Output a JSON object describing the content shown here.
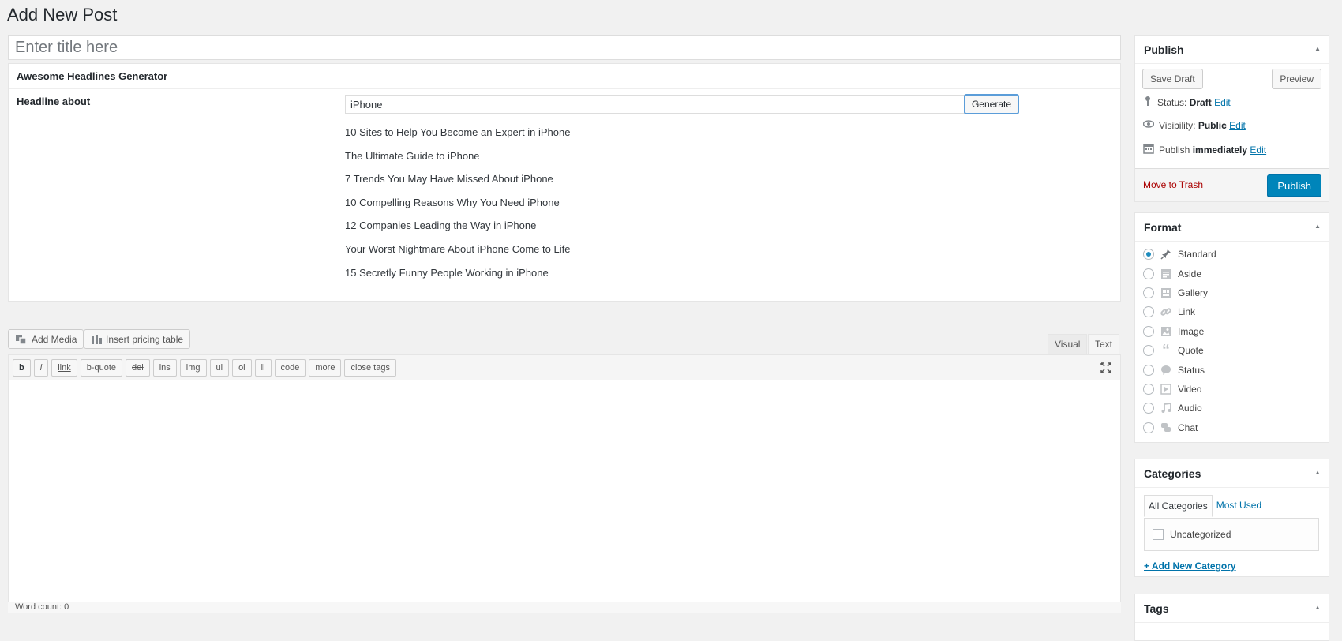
{
  "page": {
    "title": "Add New Post"
  },
  "title_field": {
    "placeholder": "Enter title here"
  },
  "headlines": {
    "box_title": "Awesome Headlines Generator",
    "label": "Headline about",
    "input_value": "iPhone",
    "generate_label": "Generate",
    "results": [
      "10 Sites to Help You Become an Expert in iPhone",
      "The Ultimate Guide to iPhone",
      "7 Trends You May Have Missed About iPhone",
      "10 Compelling Reasons Why You Need iPhone",
      "12 Companies Leading the Way in iPhone",
      "Your Worst Nightmare About iPhone Come to Life",
      "15 Secretly Funny People Working in iPhone"
    ]
  },
  "media": {
    "add_media": "Add Media",
    "insert_pricing": "Insert pricing table"
  },
  "editor": {
    "tabs": [
      "Visual",
      "Text"
    ],
    "active_tab": "Text",
    "quicktags": [
      "b",
      "i",
      "link",
      "b-quote",
      "del",
      "ins",
      "img",
      "ul",
      "ol",
      "li",
      "code",
      "more",
      "close tags"
    ],
    "word_count": "Word count: 0"
  },
  "publish": {
    "title": "Publish",
    "save_draft": "Save Draft",
    "preview": "Preview",
    "status_label": "Status:",
    "status_value": "Draft",
    "visibility_label": "Visibility:",
    "visibility_value": "Public",
    "publish_label": "Publish",
    "publish_value": "immediately",
    "edit": "Edit",
    "trash": "Move to Trash",
    "publish_button": "Publish"
  },
  "format": {
    "title": "Format",
    "selected": "Standard",
    "options": [
      {
        "label": "Standard",
        "icon": "pin-icon"
      },
      {
        "label": "Aside",
        "icon": "aside-icon"
      },
      {
        "label": "Gallery",
        "icon": "gallery-icon"
      },
      {
        "label": "Link",
        "icon": "link-icon"
      },
      {
        "label": "Image",
        "icon": "image-icon"
      },
      {
        "label": "Quote",
        "icon": "quote-icon"
      },
      {
        "label": "Status",
        "icon": "status-icon"
      },
      {
        "label": "Video",
        "icon": "video-icon"
      },
      {
        "label": "Audio",
        "icon": "audio-icon"
      },
      {
        "label": "Chat",
        "icon": "chat-icon"
      }
    ]
  },
  "categories": {
    "title": "Categories",
    "tab_all": "All Categories",
    "tab_most_used": "Most Used",
    "items": [
      "Uncategorized"
    ],
    "add_new": "+ Add New Category"
  },
  "tags": {
    "title": "Tags"
  },
  "colors": {
    "accent": "#0085ba",
    "link": "#0073aa",
    "trash": "#aa0000"
  }
}
